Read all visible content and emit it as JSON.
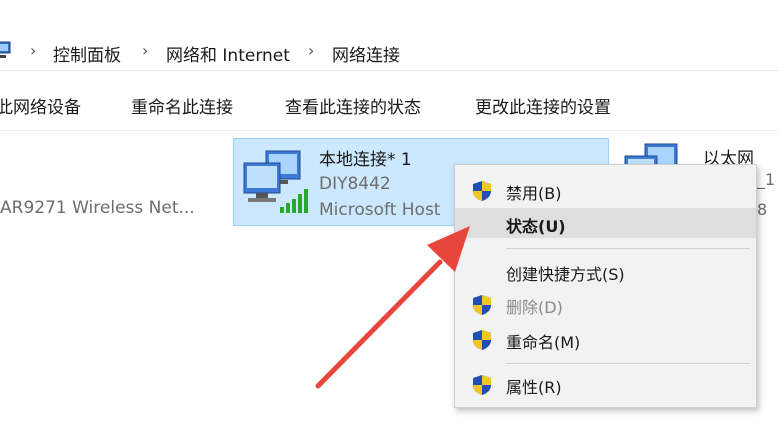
{
  "breadcrumb": {
    "items": [
      "控制面板",
      "网络和 Internet",
      "网络连接"
    ],
    "separator": "›"
  },
  "toolbar": {
    "buttons": [
      "此网络设备",
      "重命名此连接",
      "查看此连接的状态",
      "更改此连接的设置"
    ]
  },
  "adapters": {
    "left": {
      "device": "AR9271 Wireless Net..."
    },
    "selected": {
      "name": "本地连接* 1",
      "ssid": "DIY8442",
      "device": "Microsoft Host"
    },
    "right": {
      "name": "以太网",
      "fragment1": "_1",
      "fragment2": "8"
    }
  },
  "context_menu": {
    "items": [
      {
        "label": "禁用(B)",
        "icon": "shield-icon",
        "state": "normal"
      },
      {
        "label": "状态(U)",
        "icon": "",
        "state": "default-hover"
      },
      {
        "label": "创建快捷方式(S)",
        "icon": "",
        "state": "normal"
      },
      {
        "label": "删除(D)",
        "icon": "shield-icon",
        "state": "disabled"
      },
      {
        "label": "重命名(M)",
        "icon": "shield-icon",
        "state": "normal"
      },
      {
        "label": "属性(R)",
        "icon": "shield-icon",
        "state": "normal"
      }
    ]
  },
  "colors": {
    "selection_fill": "#cce8ff",
    "selection_border": "#99d1ff",
    "menu_bg": "#f2f2f2",
    "menu_hover": "#dedede",
    "arrow": "#e8453c",
    "signal": "#2aa82a"
  }
}
